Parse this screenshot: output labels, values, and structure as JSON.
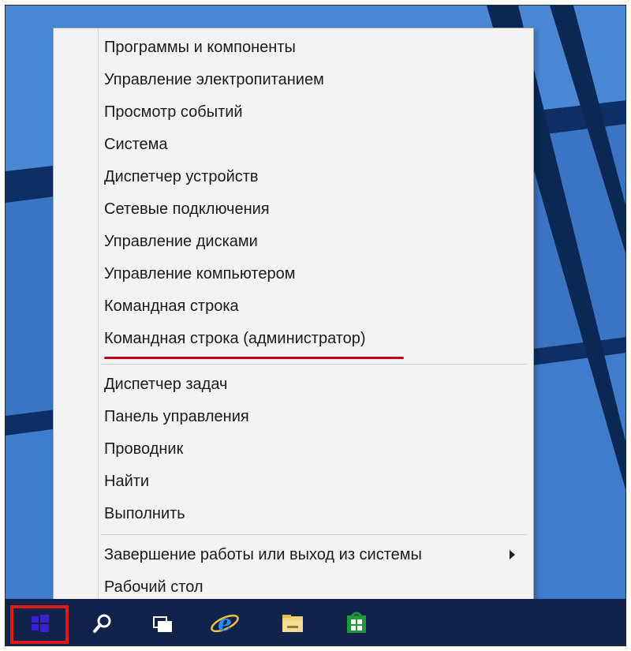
{
  "context_menu": {
    "groups": [
      {
        "items": [
          {
            "label": "Программы и компоненты"
          },
          {
            "label": "Управление электропитанием"
          },
          {
            "label": "Просмотр событий"
          },
          {
            "label": "Система"
          },
          {
            "label": "Диспетчер устройств"
          },
          {
            "label": "Сетевые подключения"
          },
          {
            "label": "Управление дисками"
          },
          {
            "label": "Управление компьютером"
          },
          {
            "label": "Командная строка"
          },
          {
            "label": "Командная строка (администратор)",
            "highlighted": true
          }
        ]
      },
      {
        "items": [
          {
            "label": "Диспетчер задач"
          },
          {
            "label": "Панель управления"
          },
          {
            "label": "Проводник"
          },
          {
            "label": "Найти"
          },
          {
            "label": "Выполнить"
          }
        ]
      },
      {
        "items": [
          {
            "label": "Завершение работы или выход из системы",
            "has_submenu": true
          },
          {
            "label": "Рабочий стол"
          }
        ]
      }
    ],
    "highlight_color": "#c0001a"
  },
  "taskbar": {
    "background": "#11234a",
    "buttons": [
      {
        "icon": "windows-logo-icon",
        "highlighted": true,
        "highlight_color": "#e01a1a"
      },
      {
        "icon": "search-icon"
      },
      {
        "icon": "task-view-icon"
      },
      {
        "icon": "internet-explorer-icon"
      },
      {
        "icon": "file-explorer-icon"
      },
      {
        "icon": "store-icon"
      }
    ]
  },
  "desktop": {
    "wallpaper_color": "#3c79c9"
  }
}
